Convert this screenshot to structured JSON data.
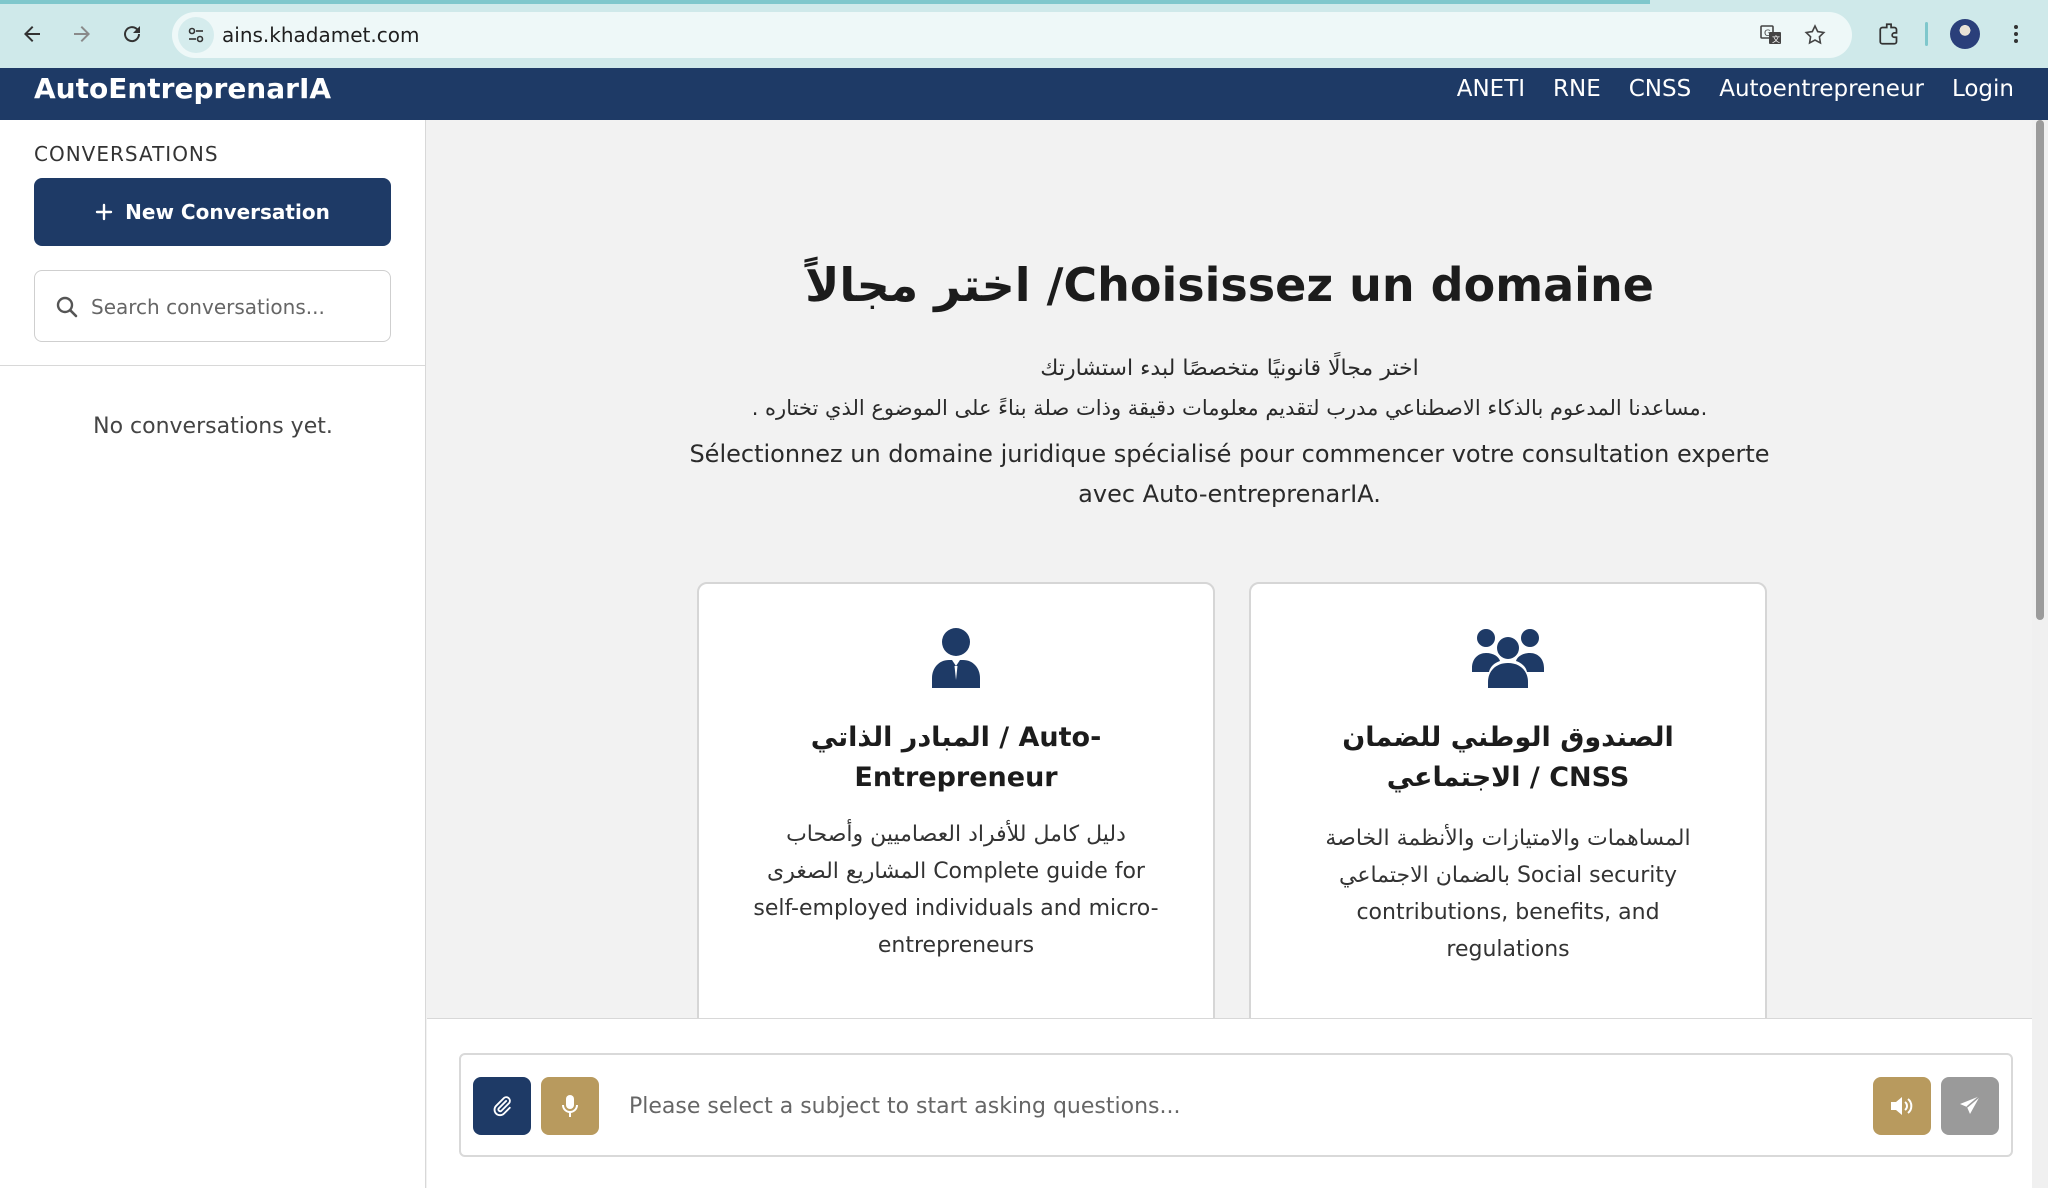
{
  "browser": {
    "url": "ains.khadamet.com"
  },
  "header": {
    "brand": "AutoEntreprenarIA",
    "nav": [
      "ANETI",
      "RNE",
      "CNSS",
      "Autoentrepreneur",
      "Login"
    ]
  },
  "sidebar": {
    "heading": "CONVERSATIONS",
    "new_conversation_label": "New Conversation",
    "search_placeholder": "Search conversations...",
    "empty_message": "No conversations yet."
  },
  "main": {
    "title": "اختر مجالاً /Choisissez un domaine",
    "subtitle_ar_1": "اختر مجالًا قانونيًا متخصصًا لبدء استشارتك",
    "subtitle_ar_2": ".مساعدنا المدعوم بالذكاء الاصطناعي مدرب لتقديم معلومات دقيقة وذات صلة بناءً على الموضوع الذي تختاره .",
    "subtitle_fr": "Sélectionnez un domaine juridique spécialisé pour commencer votre consultation experte avec Auto-entreprenarIA.",
    "cards": [
      {
        "icon": "user-tie-icon",
        "title": "المبادر الذاتي / Auto-Entrepreneur",
        "description": "دليل كامل للأفراد العصاميين وأصحاب المشاريع الصغرى Complete guide for self-employed individuals and micro-entrepreneurs"
      },
      {
        "icon": "users-icon",
        "title": "الصندوق الوطني للضمان الاجتماعي / CNSS",
        "description": "المساهمات والامتيازات والأنظمة الخاصة بالضمان الاجتماعي Social security contributions, benefits, and regulations"
      }
    ]
  },
  "chat": {
    "placeholder": "Please select a subject to start asking questions..."
  },
  "colors": {
    "primary": "#1e3a66",
    "accent_gold": "#b89a5e",
    "send_disabled": "#9a9a9a",
    "chrome_bg": "#cfe9ea"
  }
}
